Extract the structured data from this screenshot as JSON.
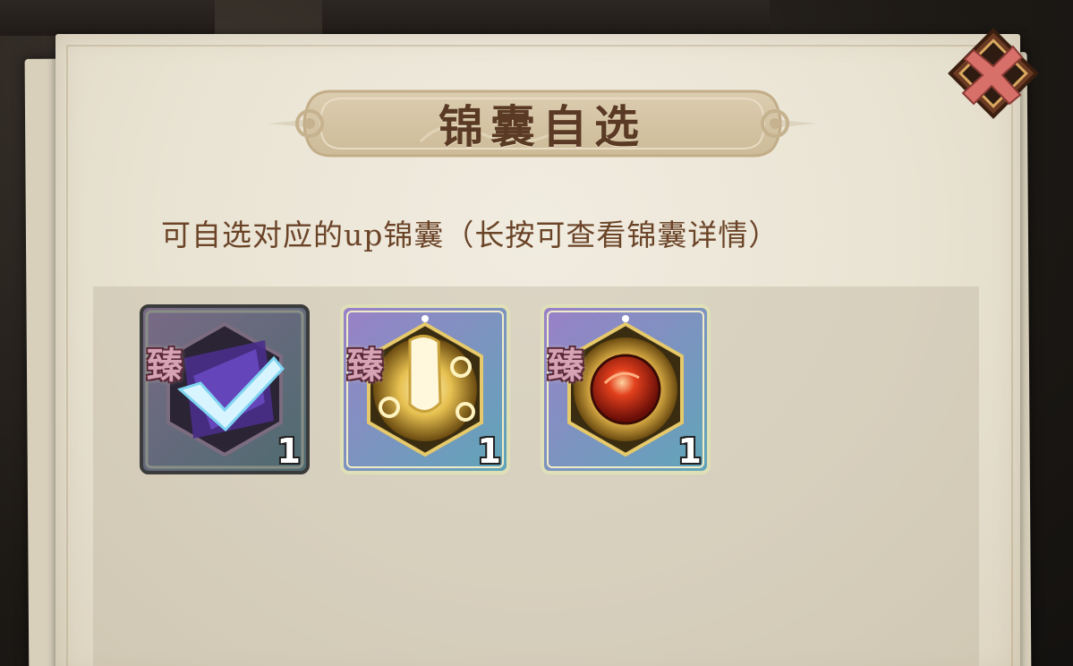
{
  "dialog": {
    "title": "锦囊自选",
    "subtitle": "可自选对应的up锦囊（长按可查看锦囊详情）",
    "close_icon": "close-x-icon"
  },
  "items": [
    {
      "badge": "臻",
      "count": "1",
      "icon": "purple-slash-check-icon",
      "selected": true
    },
    {
      "badge": "臻",
      "count": "1",
      "icon": "golden-fist-icon",
      "selected": false
    },
    {
      "badge": "臻",
      "count": "1",
      "icon": "red-fire-orb-icon",
      "selected": false
    }
  ],
  "colors": {
    "title_text": "#5a3a24",
    "subtitle_text": "#6b4428",
    "parchment": "#ebe5d6",
    "close_red": "#d8706a",
    "close_frame": "#6b3a22"
  }
}
